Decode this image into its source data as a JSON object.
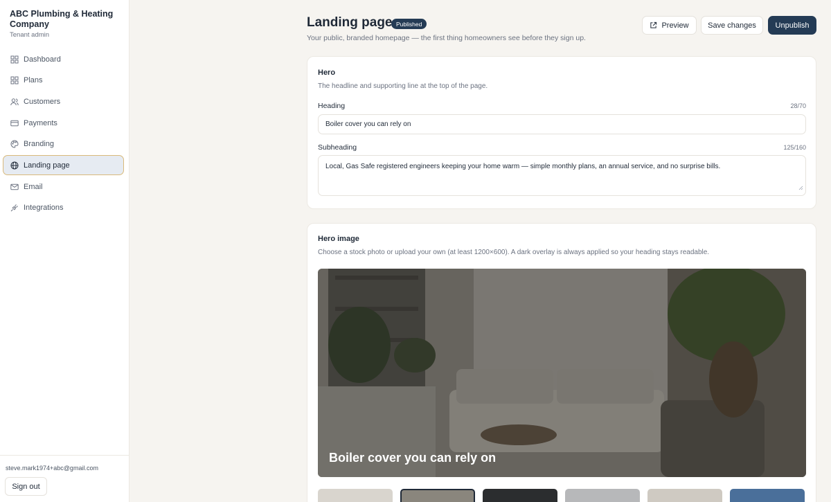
{
  "sidebar": {
    "company": "ABC Plumbing & Heating Company",
    "role": "Tenant admin",
    "items": [
      {
        "label": "Dashboard",
        "icon": "dashboard-icon"
      },
      {
        "label": "Plans",
        "icon": "plans-icon"
      },
      {
        "label": "Customers",
        "icon": "customers-icon"
      },
      {
        "label": "Payments",
        "icon": "payments-icon"
      },
      {
        "label": "Branding",
        "icon": "palette-icon"
      },
      {
        "label": "Landing page",
        "icon": "globe-icon",
        "active": true
      },
      {
        "label": "Email",
        "icon": "mail-icon"
      },
      {
        "label": "Integrations",
        "icon": "plug-icon"
      }
    ],
    "user_email": "steve.mark1974+abc@gmail.com",
    "sign_out": "Sign out"
  },
  "header": {
    "title": "Landing page",
    "status_badge": "Published",
    "subtitle": "Your public, branded homepage — the first thing homeowners see before they sign up.",
    "preview_label": "Preview",
    "save_label": "Save changes",
    "unpublish_label": "Unpublish"
  },
  "hero_section": {
    "title": "Hero",
    "description": "The headline and supporting line at the top of the page.",
    "heading_label": "Heading",
    "heading_count": "28/70",
    "heading_value": "Boiler cover you can rely on",
    "subheading_label": "Subheading",
    "subheading_count": "125/160",
    "subheading_value": "Local, Gas Safe registered engineers keeping your home warm — simple monthly plans, an annual service, and no surprise bills."
  },
  "hero_image_section": {
    "title": "Hero image",
    "description": "Choose a stock photo or upload your own (at least 1200×600). A dark overlay is always applied so your heading stays readable.",
    "preview_caption": "Boiler cover you can rely on",
    "thumbnails_selected_index": 1
  },
  "colors": {
    "accent": "#243b55",
    "active_border": "#d9b97a",
    "background": "#f6f4f0"
  }
}
